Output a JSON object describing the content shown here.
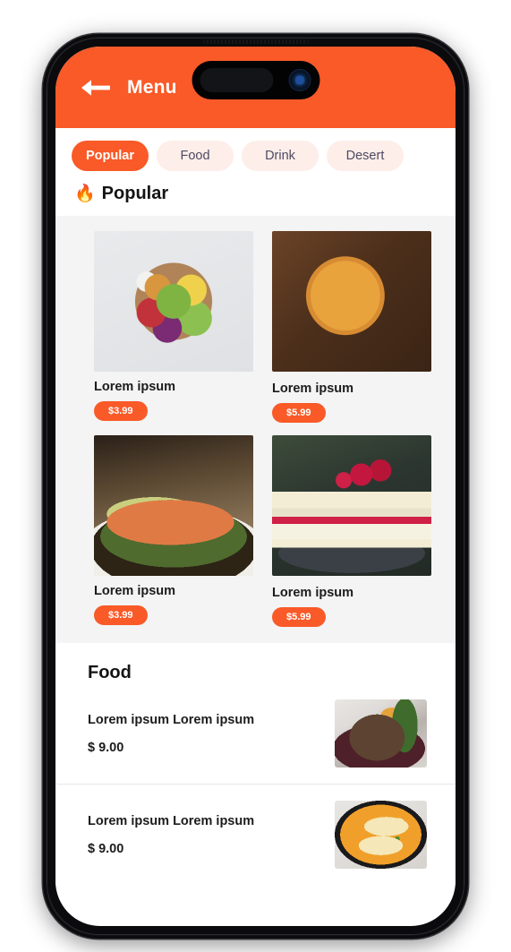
{
  "header": {
    "back_icon": "arrow-left-icon",
    "title": "Menu",
    "background_color": "#F95A28"
  },
  "tabs": [
    {
      "label": "Popular",
      "active": true
    },
    {
      "label": "Food",
      "active": false
    },
    {
      "label": "Drink",
      "active": false
    },
    {
      "label": "Desert",
      "active": false
    }
  ],
  "popular_section": {
    "icon": "fire-icon",
    "icon_glyph": "🔥",
    "heading": "Popular",
    "background_color": "#F4F4F5",
    "items": [
      {
        "title": "Lorem ipsum",
        "price": "$3.99",
        "image": "salad-bowl-image"
      },
      {
        "title": "Lorem ipsum",
        "price": "$5.99",
        "image": "bbq-chicken-pizza-image"
      },
      {
        "title": "Lorem ipsum",
        "price": "$3.99",
        "image": "salmon-plate-image"
      },
      {
        "title": "Lorem ipsum",
        "price": "$5.99",
        "image": "raspberry-cake-image"
      }
    ]
  },
  "food_section": {
    "heading": "Food",
    "items": [
      {
        "name": "Lorem ipsum Lorem ipsum",
        "price": "$ 9.00",
        "image": "steak-plate-image"
      },
      {
        "name": "Lorem ipsum Lorem ipsum",
        "price": "$ 9.00",
        "image": "curry-pan-image"
      }
    ]
  },
  "colors": {
    "accent": "#F95A28",
    "tab_inactive_bg": "#FDEEE9",
    "tab_inactive_text": "#4D4A63",
    "section_bg": "#F4F4F5",
    "divider": "#E6E6E8"
  }
}
